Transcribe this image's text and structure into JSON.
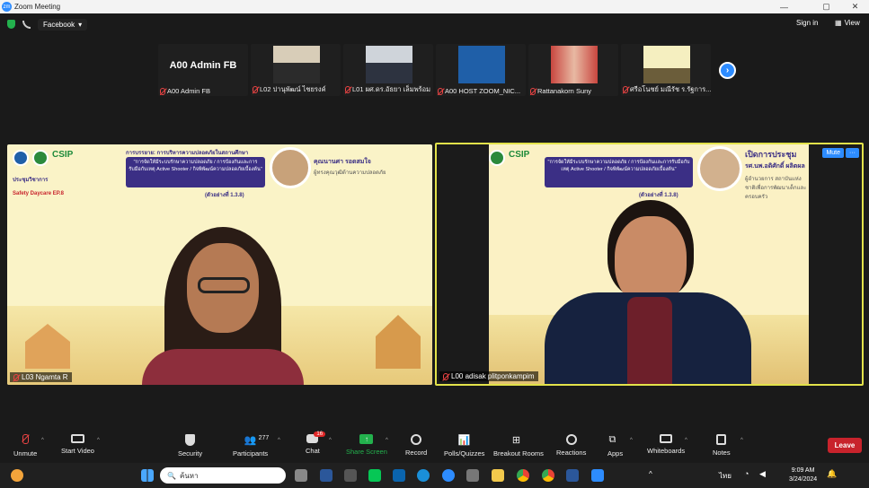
{
  "window": {
    "title": "Zoom Meeting",
    "app_icon": "zm"
  },
  "window_controls": [
    "—",
    "▢",
    "✕"
  ],
  "topbar": {
    "dropdown_label": "Facebook",
    "signin_label": "Sign in",
    "view_label": "View"
  },
  "thumbnails": [
    {
      "name": "A00 Admin FB",
      "big_name": "A00 Admin FB",
      "muted": true
    },
    {
      "name": "L02 ปานุพัฒน์ ไชยรงค์",
      "muted": true
    },
    {
      "name": "L01 ผศ.ดร.อัธยา เล็มพร้อม",
      "muted": true
    },
    {
      "name": "A00 HOST ZOOM_NIC...",
      "muted": true
    },
    {
      "name": "Rattanakorn Suny",
      "muted": true
    },
    {
      "name": "ศรีอโนชย์ มณีรัช ร.รัฐการ...",
      "muted": true
    }
  ],
  "next_label": "›",
  "left_tile": {
    "name": "L03 Ngamta R",
    "csip": "CSIP",
    "slide_title": "การบรรยาย: การบริหารความปลอดภัยในสถานศึกษา",
    "banner": "\"การจัดให้มีระบบรักษาความปลอดภัย / การป้องกันและการรับมือกับเหตุ Active Shooter / กิจพิพัฒน์ความปลอดภัยเบื้องต้น\"",
    "banner_sub": "(ตัวอย่างที่ 1.3.8)",
    "event": "ประชุมวิชาการ",
    "event_sub": "Safety Daycare EP.8",
    "speaker_name": "คุณนานศา รอดสมใจ",
    "speaker_role": "ผู้ทรงคุณวุฒิด้านความปลอดภัย"
  },
  "right_tile": {
    "name": "L00 adisak plitponkampim",
    "csip": "CSIP",
    "mute_label": "Mute",
    "more_label": "···",
    "banner": "\"การจัดให้มีระบบรักษาความปลอดภัย / การป้องกันและการรับมือกับเหตุ Active Shooter / กิจพิพัฒน์ความปลอดภัยเบื้องต้น\"",
    "banner_sub": "(ตัวอย่างที่ 1.3.8)",
    "open_label": "เปิดการประชุม",
    "speaker_name": "รศ.นพ.อดิศักดิ์ ผลิตผล",
    "speaker_role": "ผู้อำนวยการ สถาบันแห่งชาติเพื่อการพัฒนาเด็กและครอบครัว"
  },
  "toolbar": {
    "unmute": "Unmute",
    "start_video": "Start Video",
    "security": "Security",
    "participants": "Participants",
    "participants_count": "277",
    "chat": "Chat",
    "chat_badge": "16",
    "share_screen": "Share Screen",
    "record": "Record",
    "polls": "Polls/Quizzes",
    "breakout": "Breakout Rooms",
    "reactions": "Reactions",
    "apps": "Apps",
    "whiteboards": "Whiteboards",
    "notes": "Notes",
    "leave": "Leave"
  },
  "taskbar": {
    "search_placeholder": "ค้นหา",
    "clock_time": "9:09 AM",
    "clock_date": "3/24/2024",
    "lang": "ไทย"
  },
  "colors": {
    "accent": "#2d8cff",
    "leave": "#c8232c",
    "active_border": "#e2e24a",
    "share": "#23b14d"
  }
}
